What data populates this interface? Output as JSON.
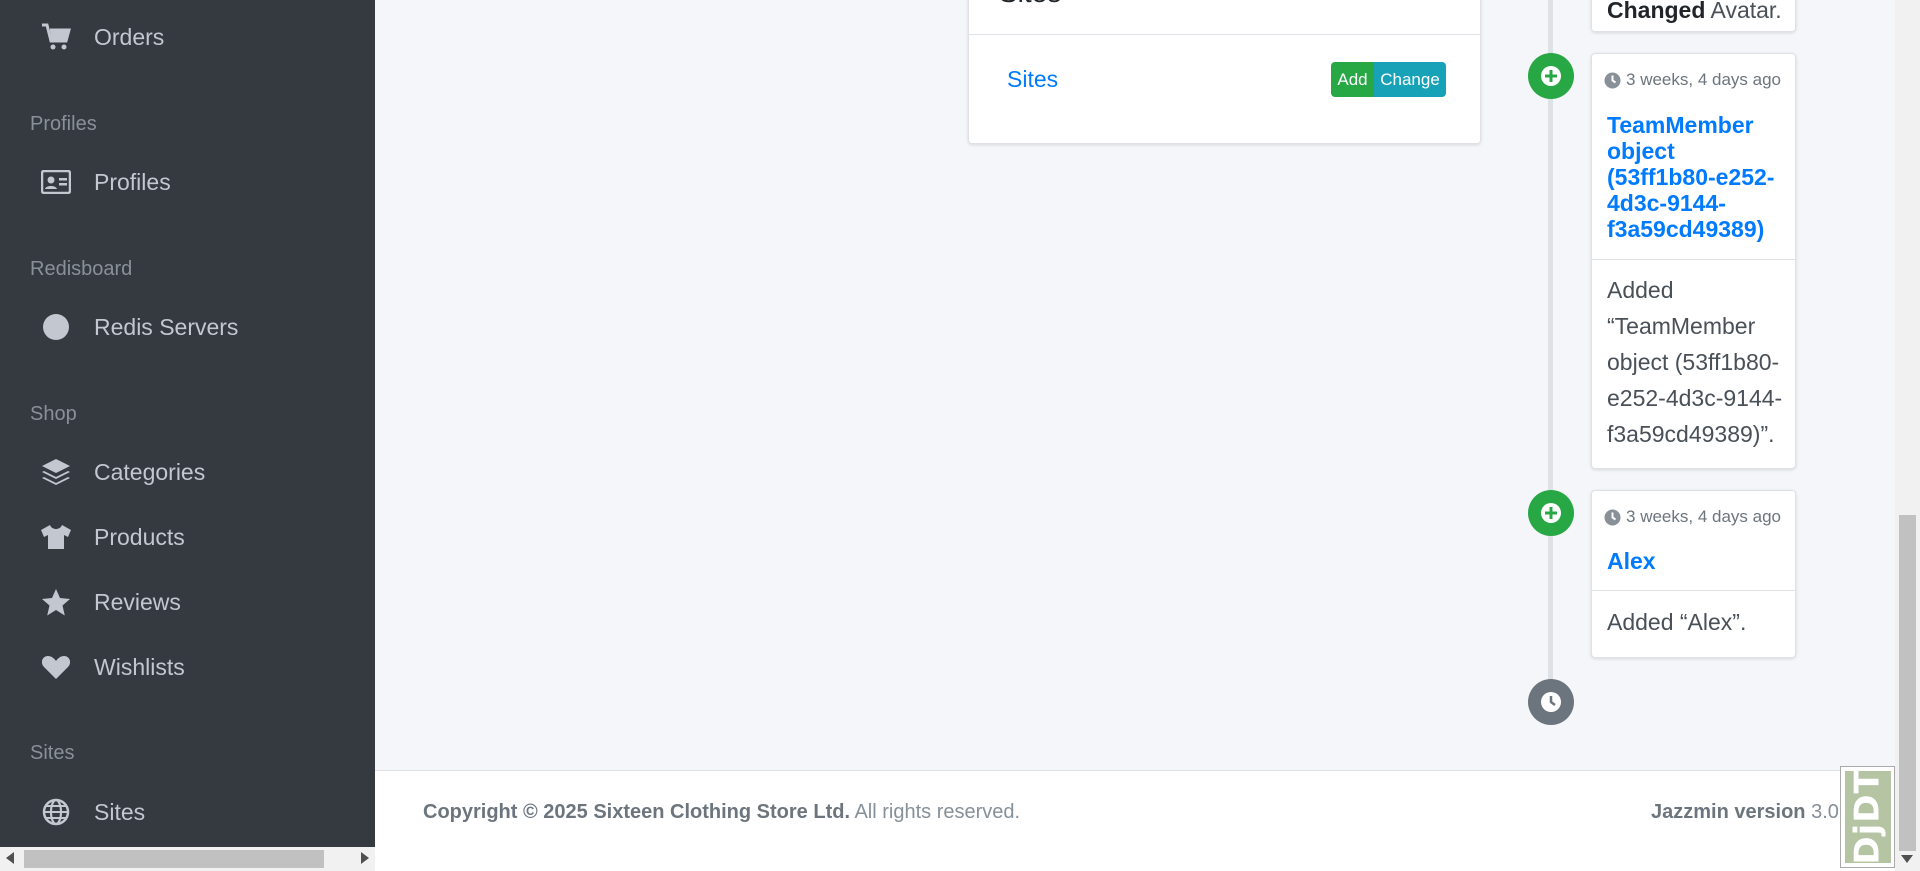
{
  "sidebar": {
    "items": [
      {
        "label": "Orders",
        "icon": "shopping-cart-icon"
      },
      {
        "header": "Profiles"
      },
      {
        "label": "Profiles",
        "icon": "id-card-icon"
      },
      {
        "header": "Redisboard"
      },
      {
        "label": "Redis Servers",
        "icon": "circle-icon"
      },
      {
        "header": "Shop"
      },
      {
        "label": "Categories",
        "icon": "layers-icon"
      },
      {
        "label": "Products",
        "icon": "tshirt-icon"
      },
      {
        "label": "Reviews",
        "icon": "star-icon"
      },
      {
        "label": "Wishlists",
        "icon": "heart-icon"
      },
      {
        "header": "Sites"
      },
      {
        "label": "Sites",
        "icon": "globe-icon"
      }
    ]
  },
  "sites_card": {
    "title": "Sites",
    "link_label": "Sites",
    "add_label": "Add",
    "change_label": "Change"
  },
  "timeline": {
    "top_partial": {
      "bold": "Changed",
      "rest": "Avatar."
    },
    "entries": [
      {
        "time": "3 weeks, 4 days ago",
        "title": "TeamMember object (53ff1b80-e252-4d3c-9144-f3a59cd49389)",
        "body": "Added “TeamMember object (53ff1b80-e252-4d3c-9144-f3a59cd49389)”."
      },
      {
        "time": "3 weeks, 4 days ago",
        "title": "Alex",
        "body": "Added “Alex”."
      }
    ]
  },
  "footer": {
    "copyright_bold": "Copyright © 2025 Sixteen Clothing Store Ltd.",
    "copyright_rest": " All rights reserved.",
    "version_bold": "Jazzmin version",
    "version_value": " 3.0.0"
  },
  "djdt": {
    "label": "DjDT"
  },
  "colors": {
    "sidebar_bg": "#343a40",
    "link": "#007bff",
    "success": "#28a745",
    "info": "#17a2b8",
    "secondary": "#6c757d"
  }
}
